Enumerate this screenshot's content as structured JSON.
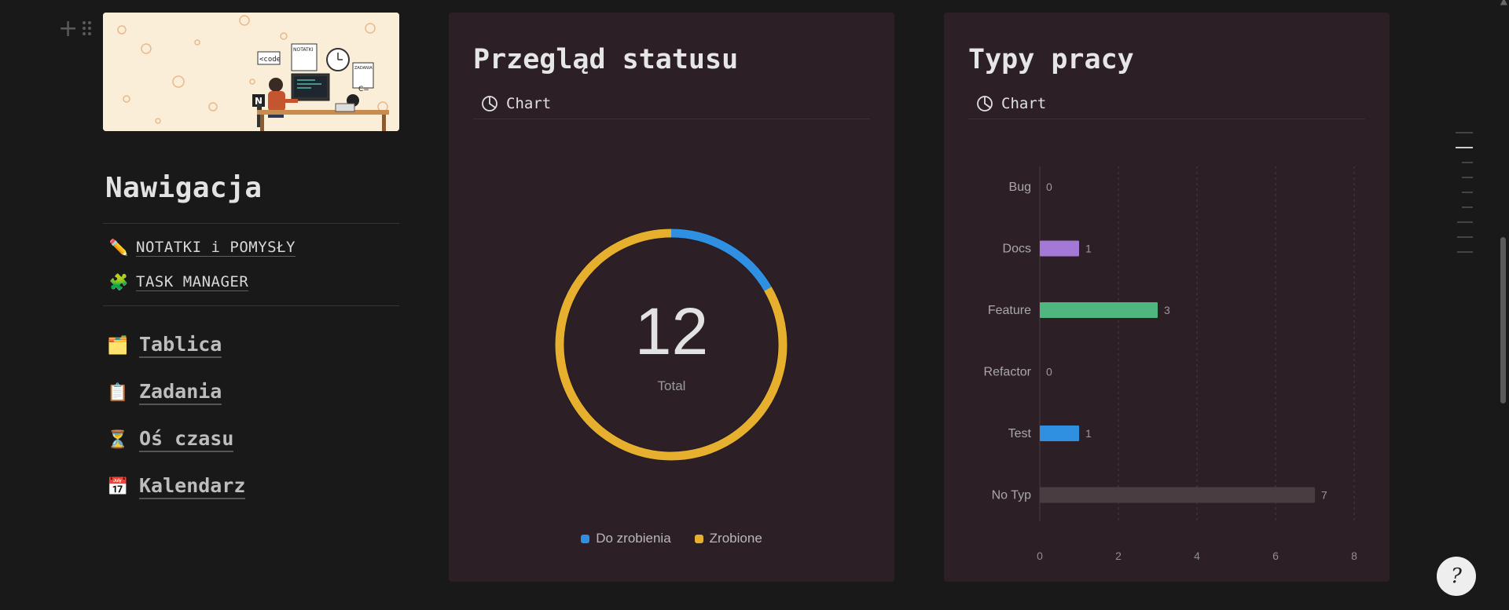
{
  "navigation": {
    "title": "Nawigacja",
    "links": [
      {
        "icon": "pencil-icon",
        "glyph": "✏️",
        "label": "NOTATKI i POMYSŁY"
      },
      {
        "icon": "puzzle-icon",
        "glyph": "🧩",
        "label": "TASK MANAGER"
      }
    ],
    "pages": [
      {
        "icon": "folder-icon",
        "glyph": "🗂️",
        "label": "Tablica"
      },
      {
        "icon": "clipboard-icon",
        "glyph": "📋",
        "label": "Zadania"
      },
      {
        "icon": "hourglass-icon",
        "glyph": "⏳",
        "label": "Oś czasu"
      },
      {
        "icon": "calendar-icon",
        "glyph": "📅",
        "label": "Kalendarz"
      }
    ]
  },
  "cover": {
    "labels": {
      "code": "<code",
      "notes": "NOTATKI",
      "tasks": "ZADANIA"
    }
  },
  "status_card": {
    "title": "Przegląd statusu",
    "view_label": "Chart",
    "center_value": "12",
    "center_label": "Total",
    "legend": [
      {
        "label": "Do zrobienia",
        "color": "#2f8fe0"
      },
      {
        "label": "Zrobione",
        "color": "#e6b02e"
      }
    ]
  },
  "types_card": {
    "title": "Typy pracy",
    "view_label": "Chart"
  },
  "chart_data": [
    {
      "type": "pie",
      "title": "Przegląd statusu",
      "variant": "donut",
      "center_text": "12",
      "center_label": "Total",
      "categories": [
        "Do zrobienia",
        "Zrobione"
      ],
      "values": [
        2,
        10
      ],
      "colors": [
        "#2f8fe0",
        "#e6b02e"
      ],
      "legend": "bottom"
    },
    {
      "type": "bar",
      "orientation": "horizontal",
      "title": "Typy pracy",
      "categories": [
        "Bug",
        "Docs",
        "Feature",
        "Refactor",
        "Test",
        "No Typ"
      ],
      "values": [
        0,
        1,
        3,
        0,
        1,
        7
      ],
      "colors": [
        "#888888",
        "#a378d6",
        "#4fb67e",
        "#888888",
        "#2f8fe0",
        "#4a3d42"
      ],
      "xlim": [
        0,
        8
      ],
      "xticks": [
        0,
        2,
        4,
        6,
        8
      ],
      "grid": "vertical dashed",
      "data_labels": true
    }
  ],
  "help_button": {
    "glyph": "?"
  }
}
